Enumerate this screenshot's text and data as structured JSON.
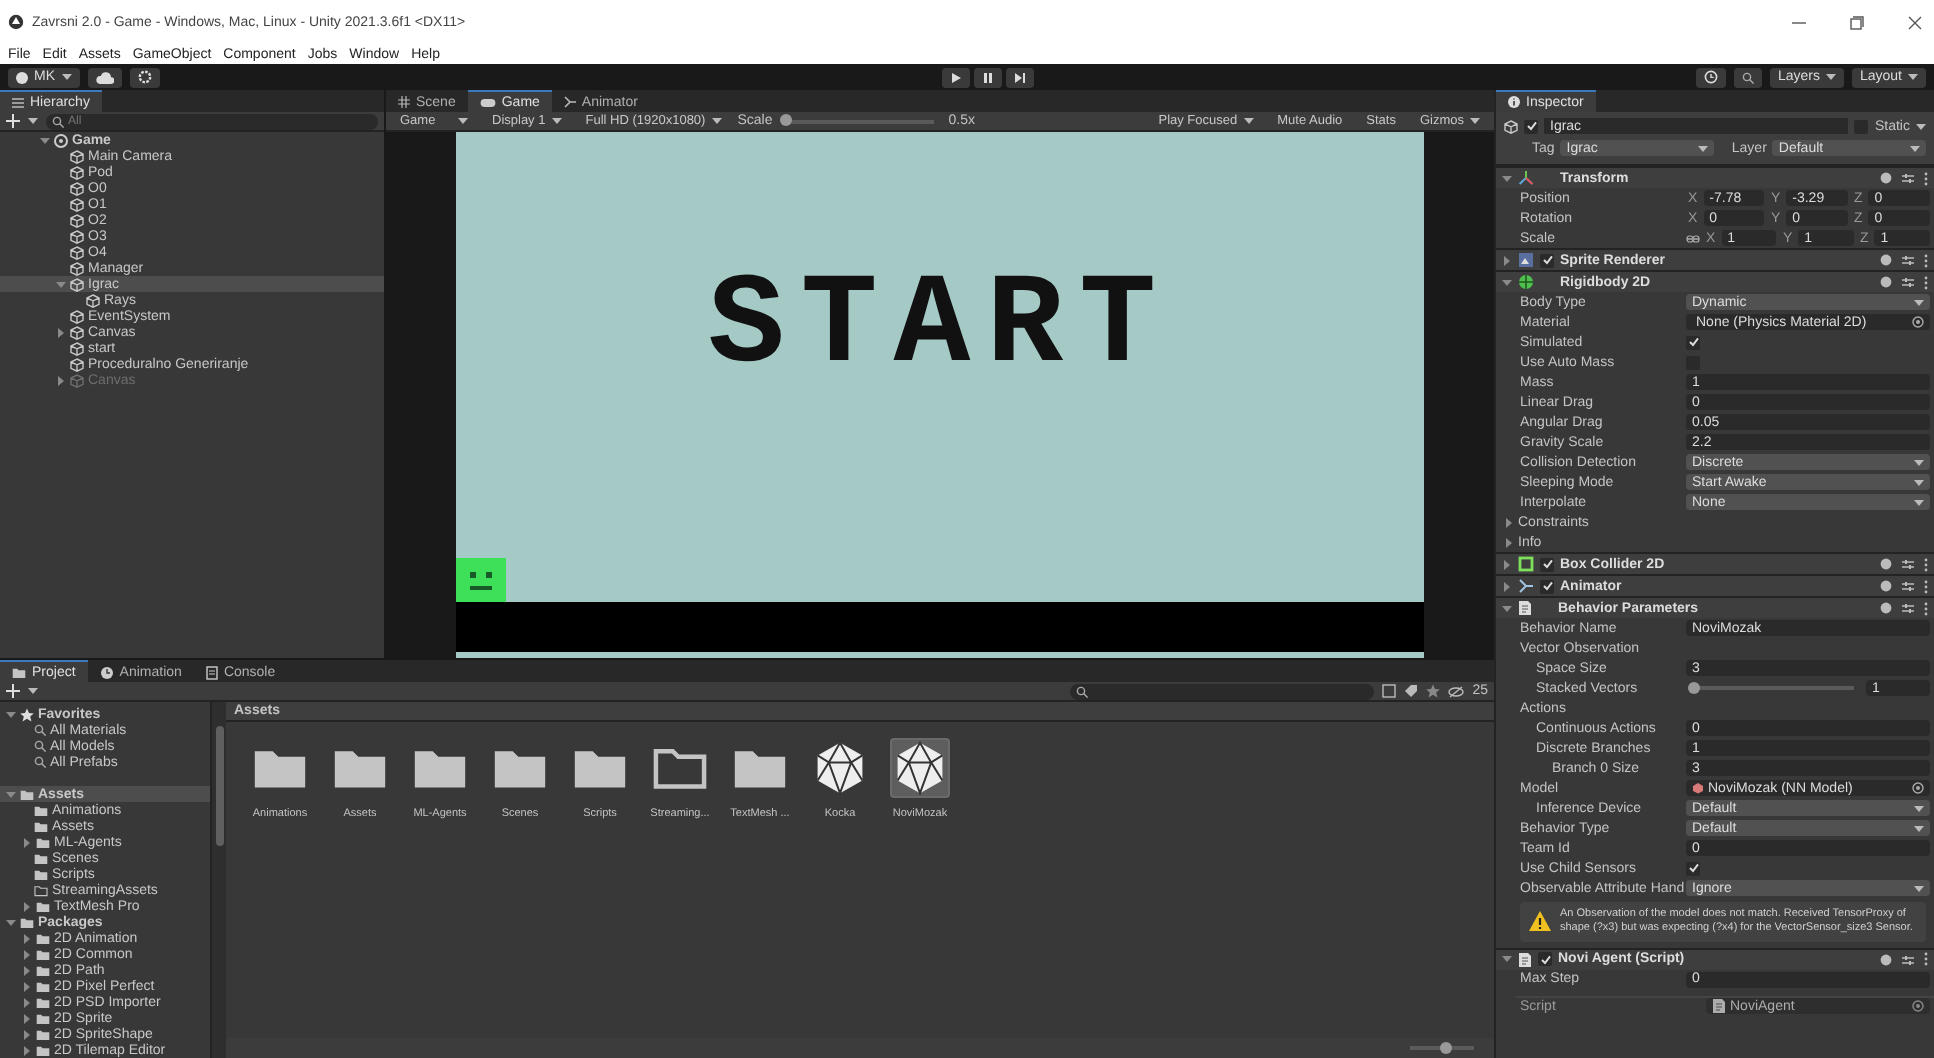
{
  "window": {
    "title": "Zavrsni 2.0 - Game - Windows, Mac, Linux - Unity 2021.3.6f1 <DX11>"
  },
  "menu": [
    "File",
    "Edit",
    "Assets",
    "GameObject",
    "Component",
    "Jobs",
    "Window",
    "Help"
  ],
  "toolbar": {
    "account": "MK",
    "layers": "Layers",
    "layout": "Layout"
  },
  "hierarchy": {
    "title": "Hierarchy",
    "placeholder": "All",
    "items": [
      {
        "label": "Game",
        "kind": "scene",
        "selected": false,
        "disabled": false,
        "expanded": true,
        "children": [
          {
            "label": "Main Camera",
            "kind": "object",
            "selected": false,
            "disabled": false
          },
          {
            "label": "Pod",
            "kind": "object",
            "selected": false,
            "disabled": false
          },
          {
            "label": "O0",
            "kind": "object",
            "selected": false,
            "disabled": false
          },
          {
            "label": "O1",
            "kind": "object",
            "selected": false,
            "disabled": false
          },
          {
            "label": "O2",
            "kind": "object",
            "selected": false,
            "disabled": false
          },
          {
            "label": "O3",
            "kind": "object",
            "selected": false,
            "disabled": false
          },
          {
            "label": "O4",
            "kind": "object",
            "selected": false,
            "disabled": false
          },
          {
            "label": "Manager",
            "kind": "object",
            "selected": false,
            "disabled": false
          },
          {
            "label": "Igrac",
            "kind": "object",
            "selected": true,
            "disabled": false,
            "expanded": true,
            "children": [
              {
                "label": "Rays",
                "kind": "object",
                "selected": false,
                "disabled": false
              }
            ]
          },
          {
            "label": "EventSystem",
            "kind": "object",
            "selected": false,
            "disabled": false
          },
          {
            "label": "Canvas",
            "kind": "object",
            "selected": false,
            "disabled": false,
            "expanded": false
          },
          {
            "label": "start",
            "kind": "object",
            "selected": false,
            "disabled": false
          },
          {
            "label": "Proceduralno Generiranje",
            "kind": "object",
            "selected": false,
            "disabled": false
          },
          {
            "label": "Canvas",
            "kind": "object",
            "selected": false,
            "disabled": true,
            "expanded": false
          }
        ]
      }
    ]
  },
  "game_view": {
    "tabs": [
      {
        "label": "Scene",
        "kind": "scene",
        "selected": false
      },
      {
        "label": "Game",
        "kind": "game",
        "selected": true
      },
      {
        "label": "Animator",
        "kind": "animator",
        "selected": false
      }
    ],
    "toolbar": {
      "mode": "Game",
      "display": "Display 1",
      "resolution": "Full HD (1920x1080)",
      "scale_label": "Scale",
      "scale": {
        "level": 0,
        "reading": "0.5x"
      },
      "play_mode": "Play Focused",
      "toggles": [
        {
          "label": "Mute Audio",
          "on": false
        },
        {
          "label": "Stats",
          "on": false
        }
      ],
      "gizmos": "Gizmos"
    },
    "canvas": {
      "text": "START"
    }
  },
  "inspector": {
    "title": "Inspector",
    "object": {
      "name": "Igrac",
      "active": true,
      "static_label": "Static",
      "static": false,
      "tag_label": "Tag",
      "tag": "Igrac",
      "layer_label": "Layer",
      "layer": "Default"
    },
    "components": [
      {
        "title": "Transform",
        "kind": "transform",
        "expanded": true,
        "rows": [
          {
            "kind": "vector",
            "label": "Position",
            "values": [
              {
                "axis": "X",
                "value": "-7.78"
              },
              {
                "axis": "Y",
                "value": "-3.29"
              },
              {
                "axis": "Z",
                "value": "0"
              }
            ]
          },
          {
            "kind": "vector",
            "label": "Rotation",
            "values": [
              {
                "axis": "X",
                "value": "0"
              },
              {
                "axis": "Y",
                "value": "0"
              },
              {
                "axis": "Z",
                "value": "0"
              }
            ]
          },
          {
            "kind": "vector_linked",
            "label": "Scale",
            "values": [
              {
                "axis": "X",
                "value": "1"
              },
              {
                "axis": "Y",
                "value": "1"
              },
              {
                "axis": "Z",
                "value": "1"
              }
            ]
          }
        ]
      },
      {
        "title": "Sprite Renderer",
        "kind": "sprite",
        "expanded": false,
        "enabled": true
      },
      {
        "title": "Rigidbody 2D",
        "kind": "rigidbody",
        "expanded": true,
        "rows": [
          {
            "kind": "dropdown",
            "label": "Body Type",
            "value": "Dynamic"
          },
          {
            "kind": "object",
            "label": "Material",
            "value": "None (Physics Material 2D)"
          },
          {
            "kind": "checkbox",
            "label": "Simulated",
            "checked": true
          },
          {
            "kind": "checkbox",
            "label": "Use Auto Mass",
            "checked": false
          },
          {
            "kind": "field",
            "label": "Mass",
            "value": "1"
          },
          {
            "kind": "field",
            "label": "Linear Drag",
            "value": "0"
          },
          {
            "kind": "field",
            "label": "Angular Drag",
            "value": "0.05"
          },
          {
            "kind": "field",
            "label": "Gravity Scale",
            "value": "2.2"
          },
          {
            "kind": "dropdown",
            "label": "Collision Detection",
            "value": "Discrete"
          },
          {
            "kind": "dropdown",
            "label": "Sleeping Mode",
            "value": "Start Awake"
          },
          {
            "kind": "dropdown",
            "label": "Interpolate",
            "value": "None"
          },
          {
            "kind": "foldout",
            "label": "Constraints",
            "expanded": false
          },
          {
            "kind": "foldout",
            "label": "Info",
            "expanded": false
          }
        ]
      },
      {
        "title": "Box Collider 2D",
        "kind": "collider",
        "expanded": false,
        "enabled": true
      },
      {
        "title": "Animator",
        "kind": "animator",
        "expanded": false,
        "enabled": true
      },
      {
        "title": "Behavior Parameters",
        "kind": "script",
        "expanded": true,
        "rows": [
          {
            "kind": "field",
            "label": "Behavior Name",
            "value": "NoviMozak"
          },
          {
            "kind": "label",
            "label": "Vector Observation",
            "children": [
              {
                "kind": "field",
                "label": "Space Size",
                "value": "3"
              },
              {
                "kind": "slider",
                "label": "Stacked Vectors",
                "level": 0,
                "reading": "1"
              }
            ]
          },
          {
            "kind": "label",
            "label": "Actions",
            "children": [
              {
                "kind": "field",
                "label": "Continuous Actions",
                "value": "0"
              },
              {
                "kind": "field",
                "label": "Discrete Branches",
                "value": "1",
                "children": [
                  {
                    "kind": "field",
                    "label": "Branch 0 Size",
                    "value": "3"
                  }
                ]
              }
            ]
          },
          {
            "kind": "asset",
            "label": "Model",
            "value": "NoviMozak (NN Model)",
            "children": [
              {
                "kind": "dropdown",
                "label": "Inference Device",
                "value": "Default"
              }
            ]
          },
          {
            "kind": "dropdown",
            "label": "Behavior Type",
            "value": "Default"
          },
          {
            "kind": "field",
            "label": "Team Id",
            "value": "0"
          },
          {
            "kind": "checkbox",
            "label": "Use Child Sensors",
            "checked": true
          },
          {
            "kind": "dropdown",
            "label": "Observable Attribute Hand",
            "value": "Ignore"
          }
        ],
        "warning": "An Observation of the model does not match. Received TensorProxy of shape (?x3) but was expecting (?x4) for the VectorSensor_size3 Sensor."
      },
      {
        "title": "Novi Agent (Script)",
        "kind": "script",
        "expanded": true,
        "enabled": true,
        "rows": [
          {
            "kind": "field",
            "label": "Max Step",
            "value": "0"
          }
        ],
        "script": {
          "label": "Script",
          "value": "NoviAgent"
        }
      }
    ]
  },
  "project": {
    "tabs": [
      {
        "label": "Project",
        "kind": "project",
        "selected": true
      },
      {
        "label": "Animation",
        "kind": "animation",
        "selected": false
      },
      {
        "label": "Console",
        "kind": "console",
        "selected": false
      }
    ],
    "hidden_count": "25",
    "tree": [
      {
        "label": "Favorites",
        "kind": "favorites",
        "selected": false,
        "expanded": true,
        "children": [
          {
            "label": "All Materials",
            "kind": "search",
            "selected": false
          },
          {
            "label": "All Models",
            "kind": "search",
            "selected": false
          },
          {
            "label": "All Prefabs",
            "kind": "search",
            "selected": false
          }
        ]
      },
      {
        "label": "Assets",
        "kind": "root",
        "selected": true,
        "expanded": true,
        "children": [
          {
            "label": "Animations",
            "kind": "folder",
            "selected": false
          },
          {
            "label": "Assets",
            "kind": "folder",
            "selected": false
          },
          {
            "label": "ML-Agents",
            "kind": "folder",
            "selected": false,
            "expanded": false
          },
          {
            "label": "Scenes",
            "kind": "folder",
            "selected": false
          },
          {
            "label": "Scripts",
            "kind": "folder",
            "selected": false
          },
          {
            "label": "StreamingAssets",
            "kind": "empty_folder",
            "selected": false
          },
          {
            "label": "TextMesh Pro",
            "kind": "folder",
            "selected": false,
            "expanded": false
          }
        ]
      },
      {
        "label": "Packages",
        "kind": "root",
        "selected": false,
        "expanded": true,
        "children": [
          {
            "label": "2D Animation",
            "kind": "folder",
            "selected": false,
            "expanded": false
          },
          {
            "label": "2D Common",
            "kind": "folder",
            "selected": false,
            "expanded": false
          },
          {
            "label": "2D Path",
            "kind": "folder",
            "selected": false,
            "expanded": false
          },
          {
            "label": "2D Pixel Perfect",
            "kind": "folder",
            "selected": false,
            "expanded": false
          },
          {
            "label": "2D PSD Importer",
            "kind": "folder",
            "selected": false,
            "expanded": false
          },
          {
            "label": "2D Sprite",
            "kind": "folder",
            "selected": false,
            "expanded": false
          },
          {
            "label": "2D SpriteShape",
            "kind": "folder",
            "selected": false,
            "expanded": false
          },
          {
            "label": "2D Tilemap Editor",
            "kind": "folder",
            "selected": false,
            "expanded": false
          }
        ]
      }
    ],
    "breadcrumb": "Assets",
    "assets": [
      {
        "name": "Animations",
        "kind": "folder",
        "selected": false
      },
      {
        "name": "Assets",
        "kind": "folder",
        "selected": false
      },
      {
        "name": "ML-Agents",
        "kind": "folder",
        "selected": false
      },
      {
        "name": "Scenes",
        "kind": "folder",
        "selected": false
      },
      {
        "name": "Scripts",
        "kind": "folder",
        "selected": false
      },
      {
        "name": "Streaming...",
        "kind": "empty_folder",
        "selected": false
      },
      {
        "name": "TextMesh ...",
        "kind": "folder",
        "selected": false
      },
      {
        "name": "Kocka",
        "kind": "model",
        "selected": false
      },
      {
        "name": "NoviMozak",
        "kind": "model",
        "selected": true
      }
    ],
    "icon_size": {
      "level": 0.55
    }
  }
}
